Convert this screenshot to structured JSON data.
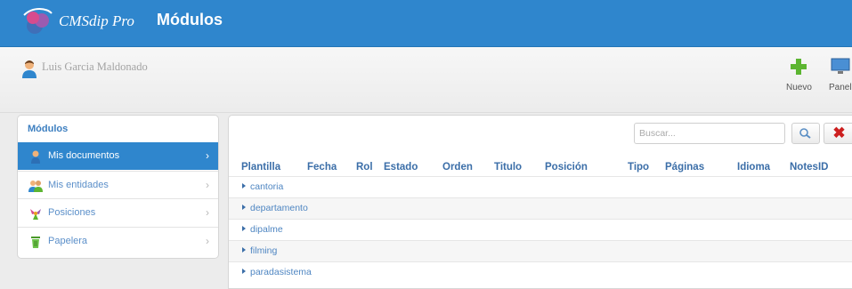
{
  "header": {
    "app_name": "CMSdip Pro",
    "page_title": "Módulos"
  },
  "userbar": {
    "user_name": "Luis Garcia Maldonado"
  },
  "toolbar": {
    "new_label": "Nuevo",
    "panel_label": "Panel"
  },
  "sidebar": {
    "title": "Módulos",
    "items": [
      {
        "label": "Mis documentos",
        "icon": "user-document-icon",
        "active": true
      },
      {
        "label": "Mis entidades",
        "icon": "users-icon",
        "active": false
      },
      {
        "label": "Posiciones",
        "icon": "positions-icon",
        "active": false
      },
      {
        "label": "Papelera",
        "icon": "trash-icon",
        "active": false
      }
    ]
  },
  "search": {
    "placeholder": "Buscar..."
  },
  "table": {
    "columns": [
      "Plantilla",
      "Fecha",
      "Rol",
      "Estado",
      "Orden",
      "Titulo",
      "Posición",
      "Tipo",
      "Páginas",
      "Idioma",
      "NotesID"
    ],
    "rows": [
      "cantoria",
      "departamento",
      "dipalme",
      "filming",
      "paradasistema"
    ]
  },
  "colors": {
    "accent": "#2f86cd",
    "link": "#4f86c2",
    "clear": "#cc1f1f"
  }
}
